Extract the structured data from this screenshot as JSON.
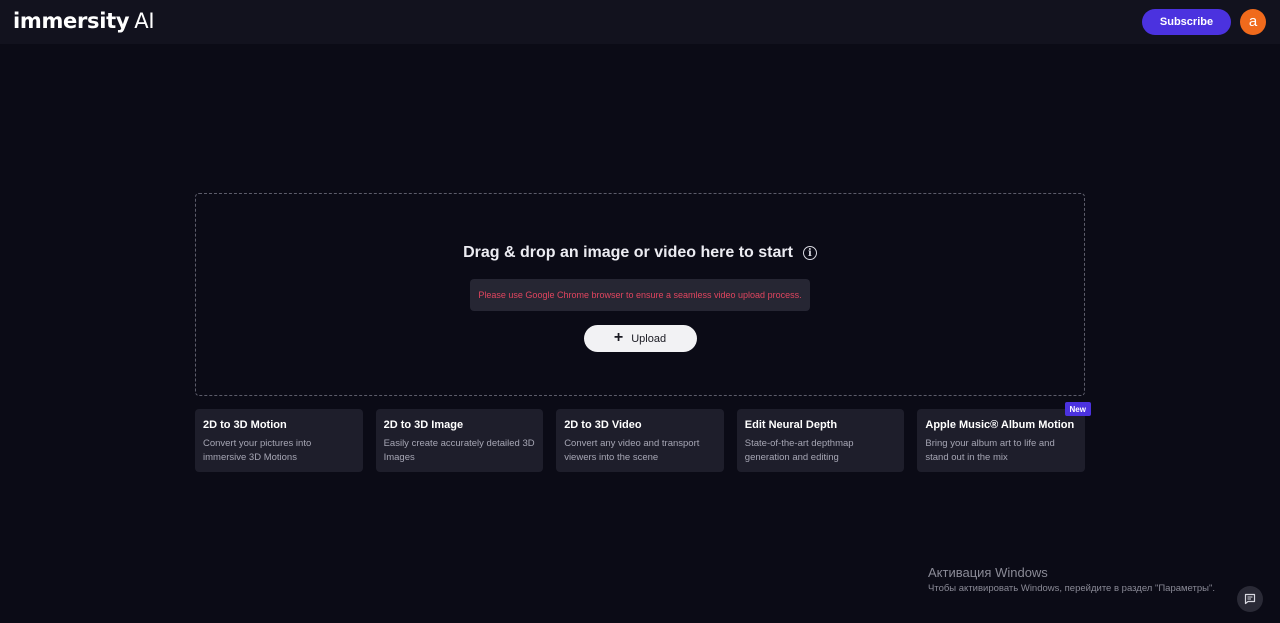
{
  "header": {
    "logo_word": "immersity",
    "logo_suffix": "AI",
    "subscribe_label": "Subscribe",
    "avatar_initial": "a"
  },
  "dropzone": {
    "title": "Drag & drop an image or video here to start",
    "info_glyph": "i",
    "browser_note": "Please use Google Chrome browser to ensure a seamless video upload process.",
    "upload_label": "Upload"
  },
  "cards": [
    {
      "title": "2D to 3D Motion",
      "desc": "Convert your pictures into immersive 3D Motions"
    },
    {
      "title": "2D to 3D Image",
      "desc": "Easily create accurately detailed 3D Images"
    },
    {
      "title": "2D to 3D Video",
      "desc": "Convert any video and transport viewers into the scene"
    },
    {
      "title": "Edit Neural Depth",
      "desc": "State-of-the-art depthmap generation and editing"
    },
    {
      "title": "Apple Music® Album Motion",
      "desc": "Bring your album art to life and stand out in the mix",
      "badge": "New"
    }
  ],
  "windows_activation": {
    "title": "Активация Windows",
    "subtitle": "Чтобы активировать Windows, перейдите в раздел \"Параметры\"."
  },
  "icons": {
    "info": "info-icon",
    "plus": "plus-icon",
    "chat": "chat-icon"
  },
  "colors": {
    "background": "#0b0b16",
    "topbar": "#12121e",
    "accent": "#4b32df",
    "avatar": "#f06a1c",
    "warning_text": "#e0455f",
    "card": "#1e1e2b"
  }
}
